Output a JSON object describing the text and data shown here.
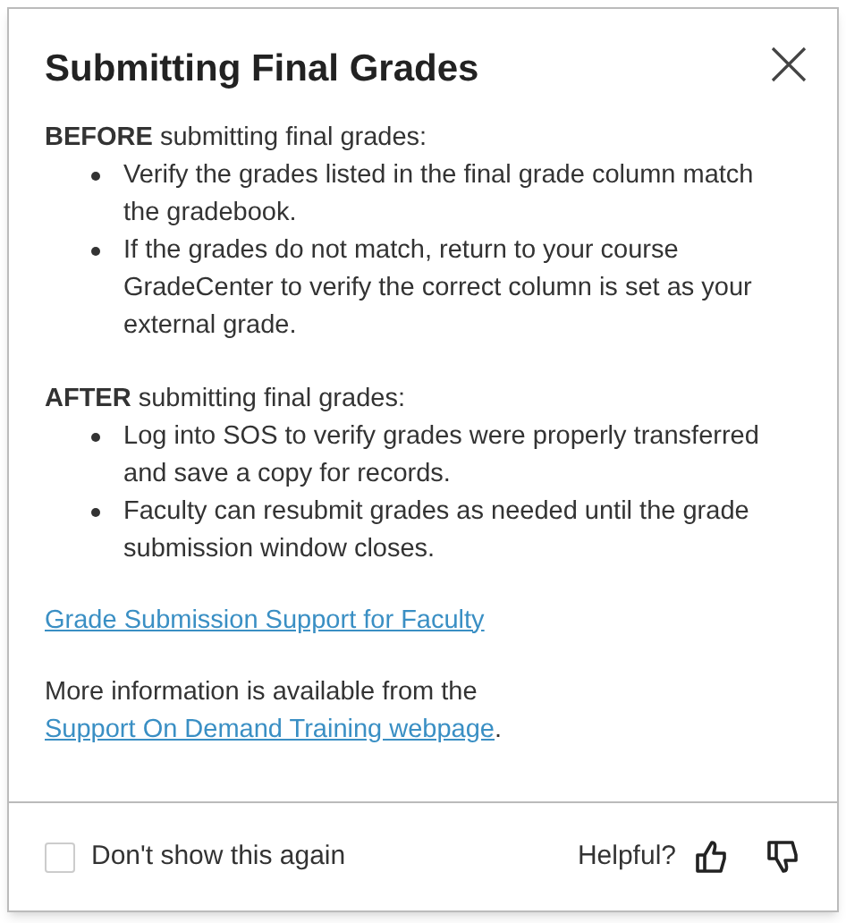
{
  "dialog": {
    "title": "Submitting Final Grades"
  },
  "sections": [
    {
      "heading": "**BEFORE** submitting final grades:",
      "bullets": [
        "Verify the grades listed in the final grade column match the gradebook.",
        "If the grades do not match, return to your course GradeCenter to verify the correct column is set as your external grade."
      ]
    },
    {
      "heading": "**AFTER** submitting final grades:",
      "bullets": [
        "Log into SOS to verify grades were properly transferred and save a copy for records.",
        "Faculty can resubmit grades as needed until the grade submission window closes."
      ]
    }
  ],
  "support_link": "Grade Submission Support for Faculty",
  "more_info": {
    "text": "More information is available from the",
    "link": "Support On Demand Training webpage",
    "suffix": "."
  },
  "footer": {
    "dont_show_again": {
      "label": "Don't show this again",
      "checked": false
    },
    "helpful_label": "Helpful?"
  }
}
